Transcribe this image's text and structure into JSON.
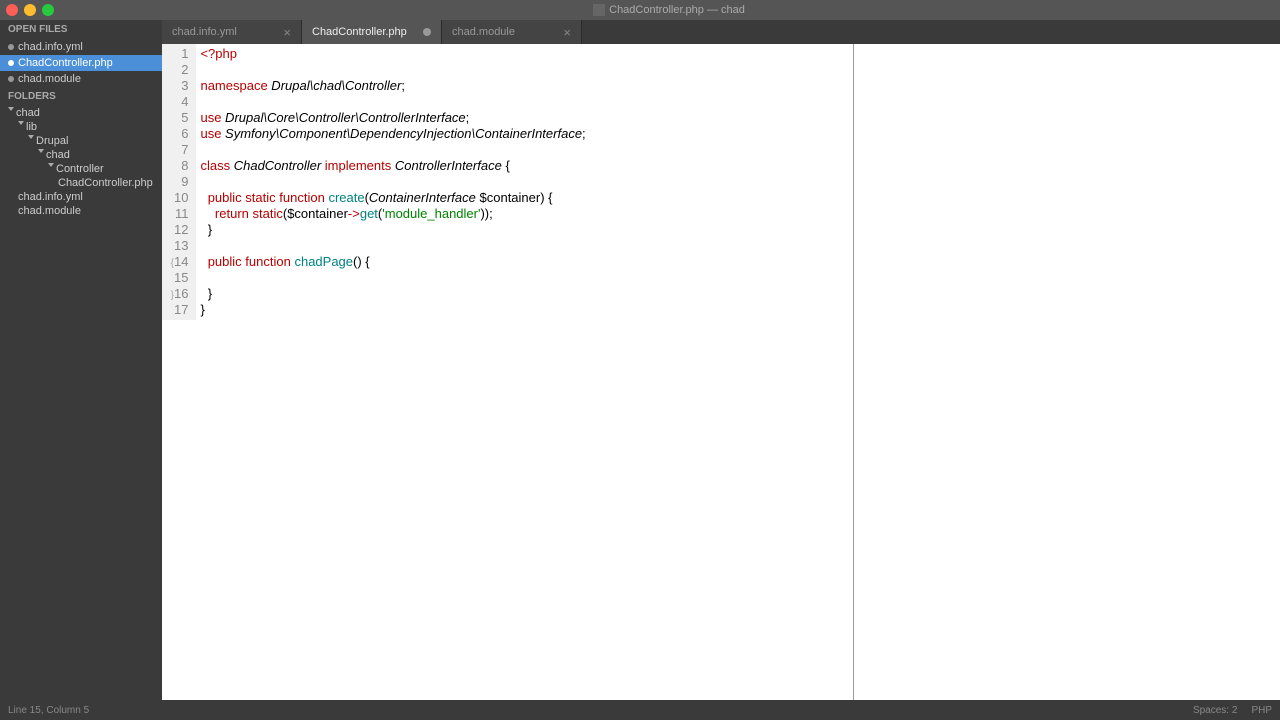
{
  "window": {
    "title": "ChadController.php — chad"
  },
  "sidebar": {
    "open_files_label": "OPEN FILES",
    "folders_label": "FOLDERS",
    "open_files": [
      {
        "name": "chad.info.yml",
        "active": false,
        "dirty": false
      },
      {
        "name": "ChadController.php",
        "active": true,
        "dirty": true
      },
      {
        "name": "chad.module",
        "active": false,
        "dirty": false
      }
    ],
    "tree": [
      {
        "name": "chad",
        "indent": 0,
        "folder": true,
        "open": true
      },
      {
        "name": "lib",
        "indent": 1,
        "folder": true,
        "open": true
      },
      {
        "name": "Drupal",
        "indent": 2,
        "folder": true,
        "open": true
      },
      {
        "name": "chad",
        "indent": 3,
        "folder": true,
        "open": true
      },
      {
        "name": "Controller",
        "indent": 4,
        "folder": true,
        "open": true
      },
      {
        "name": "ChadController.php",
        "indent": 5,
        "folder": false,
        "open": false
      },
      {
        "name": "chad.info.yml",
        "indent": 1,
        "folder": false,
        "open": false
      },
      {
        "name": "chad.module",
        "indent": 1,
        "folder": false,
        "open": false
      }
    ]
  },
  "tabs": [
    {
      "label": "chad.info.yml",
      "active": false,
      "dirty": false
    },
    {
      "label": "ChadController.php",
      "active": true,
      "dirty": true
    },
    {
      "label": "chad.module",
      "active": false,
      "dirty": false
    }
  ],
  "code": {
    "lines": [
      {
        "n": 1,
        "tokens": [
          {
            "t": "<?php",
            "c": "kw"
          }
        ]
      },
      {
        "n": 2,
        "tokens": []
      },
      {
        "n": 3,
        "tokens": [
          {
            "t": "namespace",
            "c": "kw"
          },
          {
            "t": " Drupal\\chad\\Controller",
            "c": "type"
          },
          {
            "t": ";",
            "c": ""
          }
        ]
      },
      {
        "n": 4,
        "tokens": []
      },
      {
        "n": 5,
        "tokens": [
          {
            "t": "use",
            "c": "kw"
          },
          {
            "t": " Drupal\\Core\\Controller\\",
            "c": "type"
          },
          {
            "t": "ControllerInterface",
            "c": "cls"
          },
          {
            "t": ";",
            "c": ""
          }
        ]
      },
      {
        "n": 6,
        "tokens": [
          {
            "t": "use",
            "c": "kw"
          },
          {
            "t": " Symfony\\Component\\DependencyInjection\\",
            "c": "type"
          },
          {
            "t": "ContainerInterface",
            "c": "cls"
          },
          {
            "t": ";",
            "c": ""
          }
        ]
      },
      {
        "n": 7,
        "tokens": []
      },
      {
        "n": 8,
        "tokens": [
          {
            "t": "class",
            "c": "kw"
          },
          {
            "t": " ",
            "c": ""
          },
          {
            "t": "ChadController",
            "c": "cls"
          },
          {
            "t": " ",
            "c": ""
          },
          {
            "t": "implements",
            "c": "kw"
          },
          {
            "t": " ",
            "c": ""
          },
          {
            "t": "ControllerInterface",
            "c": "cls"
          },
          {
            "t": " {",
            "c": ""
          }
        ]
      },
      {
        "n": 9,
        "tokens": []
      },
      {
        "n": 10,
        "tokens": [
          {
            "t": "  ",
            "c": ""
          },
          {
            "t": "public",
            "c": "kw"
          },
          {
            "t": " ",
            "c": ""
          },
          {
            "t": "static",
            "c": "kw"
          },
          {
            "t": " ",
            "c": ""
          },
          {
            "t": "function",
            "c": "kw"
          },
          {
            "t": " ",
            "c": ""
          },
          {
            "t": "create",
            "c": "fn"
          },
          {
            "t": "(",
            "c": ""
          },
          {
            "t": "ContainerInterface",
            "c": "type"
          },
          {
            "t": " ",
            "c": ""
          },
          {
            "t": "$container",
            "c": ""
          },
          {
            "t": ") {",
            "c": ""
          }
        ]
      },
      {
        "n": 11,
        "tokens": [
          {
            "t": "    ",
            "c": ""
          },
          {
            "t": "return",
            "c": "kw"
          },
          {
            "t": " ",
            "c": ""
          },
          {
            "t": "static",
            "c": "kw"
          },
          {
            "t": "(",
            "c": ""
          },
          {
            "t": "$container",
            "c": ""
          },
          {
            "t": "->",
            "c": "op"
          },
          {
            "t": "get",
            "c": "fn"
          },
          {
            "t": "(",
            "c": ""
          },
          {
            "t": "'module_handler'",
            "c": "str"
          },
          {
            "t": "));",
            "c": ""
          }
        ]
      },
      {
        "n": 12,
        "tokens": [
          {
            "t": "  }",
            "c": ""
          }
        ]
      },
      {
        "n": 13,
        "tokens": []
      },
      {
        "n": 14,
        "fold": "open",
        "tokens": [
          {
            "t": "  ",
            "c": ""
          },
          {
            "t": "public",
            "c": "kw"
          },
          {
            "t": " ",
            "c": ""
          },
          {
            "t": "function",
            "c": "kw"
          },
          {
            "t": " ",
            "c": ""
          },
          {
            "t": "chadPage",
            "c": "fn"
          },
          {
            "t": "() {",
            "c": ""
          }
        ]
      },
      {
        "n": 15,
        "tokens": [
          {
            "t": "    ",
            "c": ""
          }
        ]
      },
      {
        "n": 16,
        "fold": "close",
        "tokens": [
          {
            "t": "  }",
            "c": ""
          }
        ]
      },
      {
        "n": 17,
        "tokens": [
          {
            "t": "}",
            "c": ""
          }
        ]
      }
    ]
  },
  "status": {
    "left": "Line 15, Column 5",
    "spaces": "Spaces: 2",
    "lang": "PHP"
  }
}
